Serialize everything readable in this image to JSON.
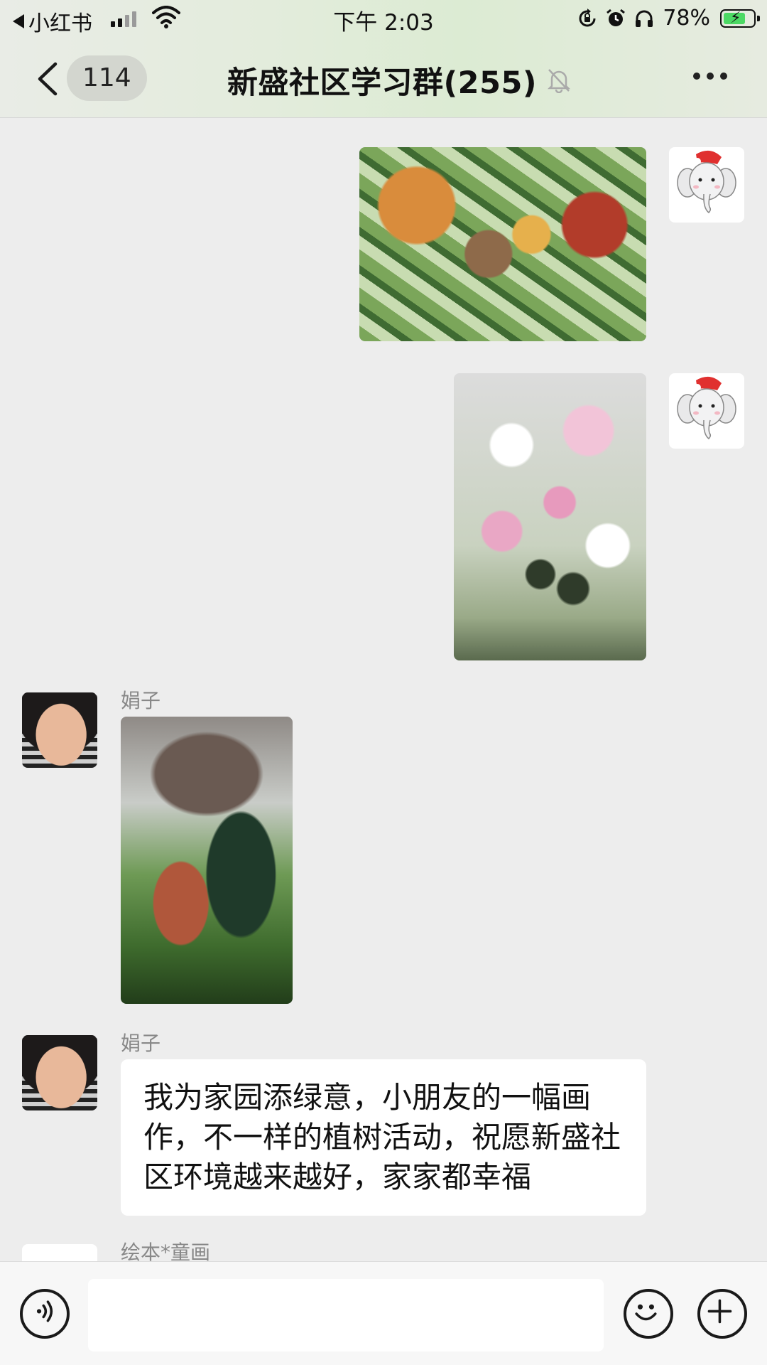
{
  "status_bar": {
    "back_app": "小红书",
    "time": "下午 2:03",
    "battery": "78%",
    "battery_level": 0.78
  },
  "nav": {
    "unread_count": "114",
    "group_title": "新盛社区学习群(255)"
  },
  "messages": [
    {
      "side": "right",
      "type": "image",
      "avatar_icon": "elephant-santa-hat-icon"
    },
    {
      "side": "right",
      "type": "image",
      "avatar_icon": "elephant-santa-hat-icon"
    },
    {
      "side": "left",
      "type": "image",
      "sender": "娟子"
    },
    {
      "side": "left",
      "type": "text",
      "sender": "娟子",
      "text": "我为家园添绿意，小朋友的一幅画作，不一样的植树活动，祝愿新盛社区环境越来越好，家家都幸福"
    },
    {
      "side": "left",
      "type": "partial",
      "sender": "绘本*童画"
    }
  ],
  "input_bar": {
    "voice_icon": "voice-icon",
    "emoji_icon": "emoji-icon",
    "plus_icon": "plus-icon"
  }
}
